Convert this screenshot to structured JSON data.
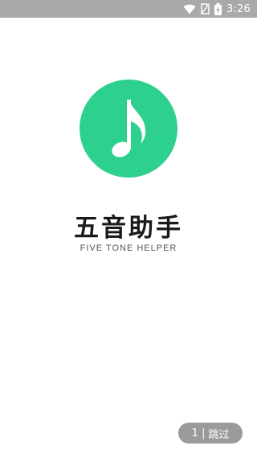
{
  "status_bar": {
    "time": "3:26",
    "icons": [
      "wifi-icon",
      "no-sim-icon",
      "battery-charging-icon"
    ]
  },
  "logo": {
    "icon": "music-note-icon",
    "circle_color": "#2ed08f"
  },
  "app": {
    "title": "五音助手",
    "subtitle": "FIVE TONE HELPER"
  },
  "skip": {
    "countdown": "1",
    "separator": "|",
    "label": "跳过"
  }
}
